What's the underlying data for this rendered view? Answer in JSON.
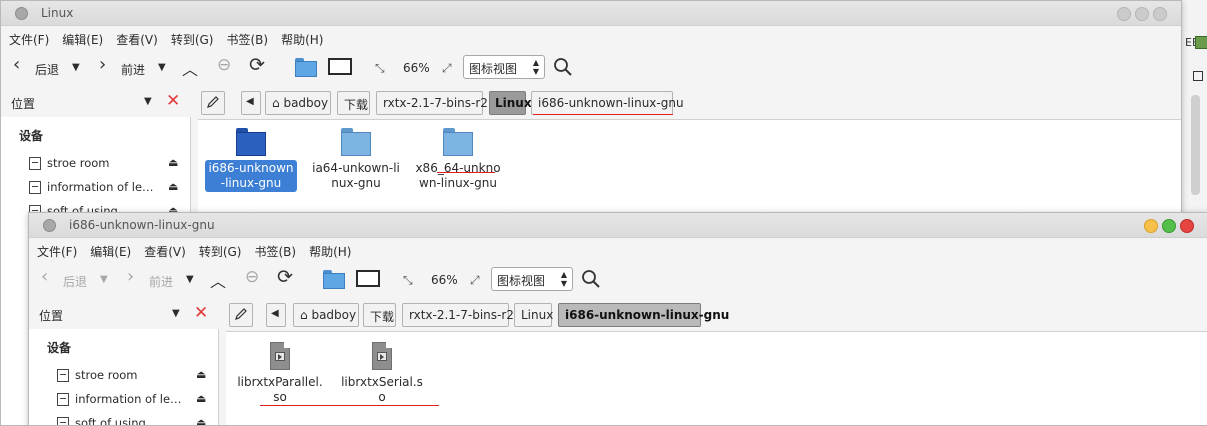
{
  "background_app": {
    "label": "EE"
  },
  "windows": [
    {
      "title": "Linux",
      "menu": [
        "文件(F)",
        "编辑(E)",
        "查看(V)",
        "转到(G)",
        "书签(B)",
        "帮助(H)"
      ],
      "toolbar": {
        "back": "后退",
        "forward": "前进",
        "zoom": "66%",
        "view_mode": "图标视图"
      },
      "sidebar": {
        "header": "位置",
        "section": "设备",
        "items": [
          "stroe room",
          "information of lea…",
          "soft of using"
        ]
      },
      "path": [
        "badboy",
        "下载",
        "rxtx-2.1-7-bins-r2",
        "Linux",
        "i686-unknown-linux-gnu"
      ],
      "active_path_index": 3,
      "files": [
        "i686-unknown-linux-gnu",
        "ia64-unkown-linux-gnu",
        "x86_64-unknown-linux-gnu"
      ],
      "selected_file_index": 0
    },
    {
      "title": "i686-unknown-linux-gnu",
      "menu": [
        "文件(F)",
        "编辑(E)",
        "查看(V)",
        "转到(G)",
        "书签(B)",
        "帮助(H)"
      ],
      "toolbar": {
        "back": "后退",
        "forward": "前进",
        "zoom": "66%",
        "view_mode": "图标视图"
      },
      "sidebar": {
        "header": "位置",
        "section": "设备",
        "items": [
          "stroe room",
          "information of lea…",
          "soft of using"
        ]
      },
      "path": [
        "badboy",
        "下载",
        "rxtx-2.1-7-bins-r2",
        "Linux",
        "i686-unknown-linux-gnu"
      ],
      "active_path_index": 4,
      "files": [
        "librxtxParallel.so",
        "librxtxSerial.so"
      ]
    }
  ],
  "colors": {
    "annotation": "#e02020",
    "selection": "#3d7fd4",
    "close_button": "#e6443f"
  }
}
